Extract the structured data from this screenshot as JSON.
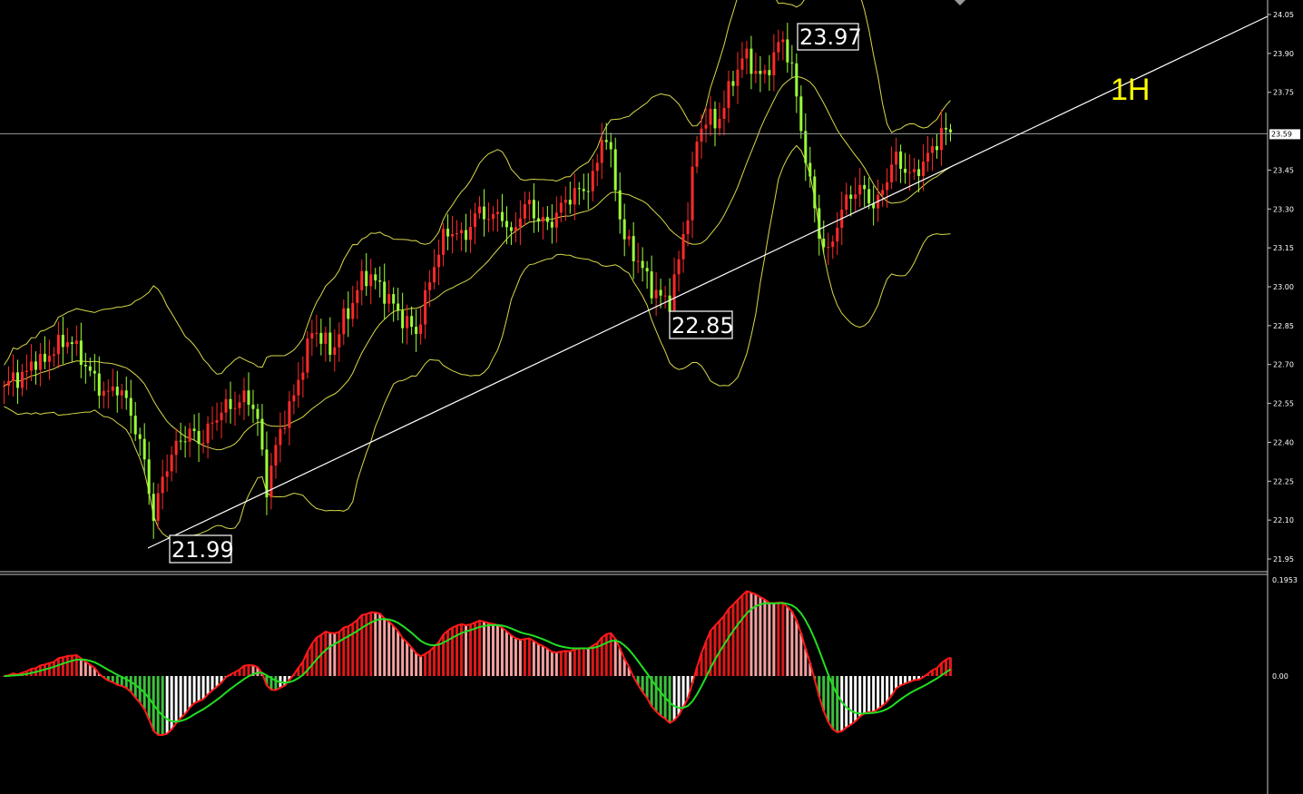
{
  "chart_data": [
    {
      "type": "candlestick",
      "timeframe_label": "1H",
      "y_axis_ticks": [
        "24.05",
        "23.90",
        "23.75",
        "23.59",
        "23.45",
        "23.30",
        "23.15",
        "23.00",
        "22.85",
        "22.70",
        "22.55",
        "22.40",
        "22.25",
        "22.10",
        "21.95"
      ],
      "current_price": 23.59,
      "price_labels": [
        "23.97",
        "22.85",
        "21.99"
      ],
      "ylim": [
        21.91,
        24.07
      ],
      "overlays": [
        "bollinger-bands",
        "ascending-trendline"
      ],
      "colors": {
        "bull": "#ff2a2a",
        "bear": "#9cff3a",
        "bands": "#d8d84a",
        "trendline": "#ffffff",
        "label": "#ffff00"
      },
      "close_series": [
        22.6,
        22.66,
        22.64,
        22.72,
        22.7,
        22.75,
        22.78,
        22.8,
        22.74,
        22.68,
        22.62,
        22.58,
        22.62,
        22.56,
        22.46,
        22.32,
        22.1,
        22.28,
        22.36,
        22.42,
        22.44,
        22.4,
        22.46,
        22.52,
        22.54,
        22.55,
        22.58,
        22.5,
        22.22,
        22.38,
        22.5,
        22.58,
        22.72,
        22.84,
        22.8,
        22.74,
        22.86,
        22.92,
        23.02,
        23.05,
        23.0,
        22.96,
        22.9,
        22.86,
        22.82,
        22.96,
        23.1,
        23.2,
        23.22,
        23.18,
        23.26,
        23.3,
        23.25,
        23.3,
        23.18,
        23.28,
        23.32,
        23.26,
        23.24,
        23.28,
        23.34,
        23.36,
        23.38,
        23.42,
        23.62,
        23.45,
        23.2,
        23.14,
        23.08,
        23.0,
        22.96,
        22.94,
        23.1,
        23.3,
        23.58,
        23.66,
        23.62,
        23.72,
        23.82,
        23.9,
        23.84,
        23.8,
        23.88,
        23.96,
        23.86,
        23.62,
        23.4,
        23.2,
        23.12,
        23.26,
        23.34,
        23.38,
        23.36,
        23.3,
        23.4,
        23.5,
        23.46,
        23.42,
        23.48,
        23.52,
        23.6,
        23.59
      ]
    },
    {
      "type": "macd",
      "y_axis_ticks": [
        "0.1953",
        "0.00"
      ],
      "colors": {
        "hist_pos_rising": "#e01818",
        "hist_pos_falling": "#f4a0a0",
        "hist_neg_falling": "#3fbf3f",
        "hist_neg_rising": "#ffffff",
        "line_macd": "#ff1a1a",
        "line_signal": "#22dd22"
      }
    }
  ],
  "price_box_23_97": "23.97",
  "price_box_22_85": "22.85",
  "price_box_21_99": "21.99",
  "timeframe": "1H",
  "current_price_label": "23.59",
  "macd_top_label": "0.1953",
  "macd_zero_label": "0.00"
}
